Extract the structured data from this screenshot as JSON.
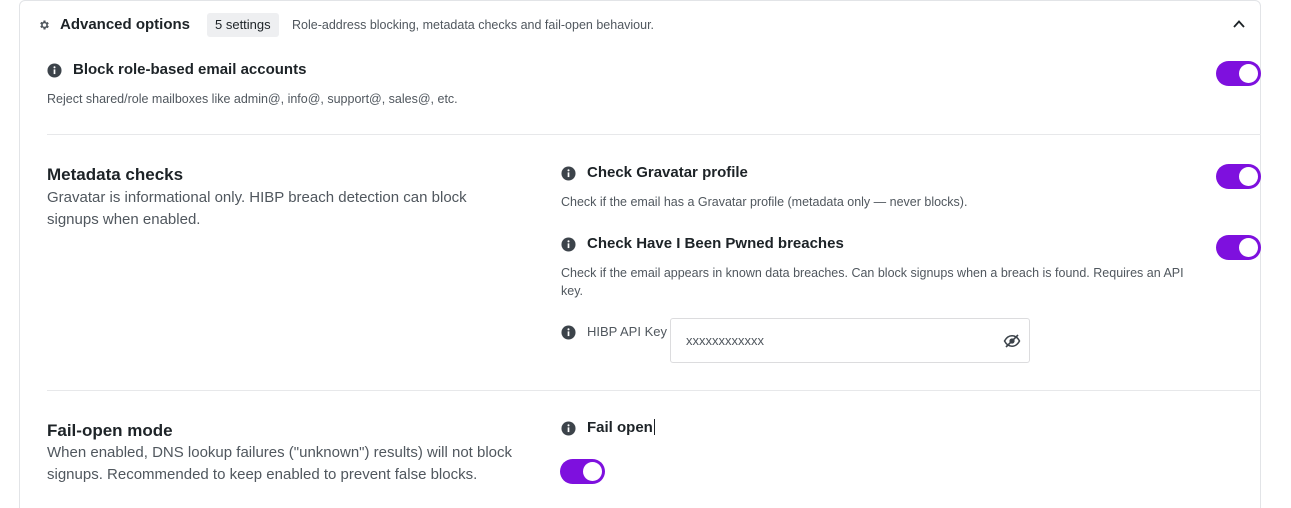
{
  "header": {
    "title": "Advanced options",
    "badge": "5 settings",
    "description": "Role-address blocking, metadata checks and fail-open behaviour."
  },
  "role_block": {
    "title": "Block role-based email accounts",
    "description": "Reject shared/role mailboxes like admin@, info@, support@, sales@, etc.",
    "enabled": true
  },
  "metadata": {
    "title": "Metadata checks",
    "description": "Gravatar is informational only. HIBP breach detection can block signups when enabled.",
    "gravatar": {
      "title": "Check Gravatar profile",
      "description": "Check if the email has a Gravatar profile (metadata only — never blocks).",
      "enabled": true
    },
    "hibp": {
      "title": "Check Have I Been Pwned breaches",
      "description": "Check if the email appears in known data breaches. Can block signups when a breach is found. Requires an API key.",
      "enabled": true
    },
    "api_key": {
      "label": "HIBP API Key",
      "value": "xxxxxxxxxxxx"
    }
  },
  "fail_open": {
    "title": "Fail-open mode",
    "description": "When enabled, DNS lookup failures (\"unknown\") results) will not block signups. Recommended to keep enabled to prevent false blocks.",
    "option_title": "Fail open",
    "enabled": true
  },
  "colors": {
    "accent": "#7e10de",
    "text": "#1d2327",
    "muted": "#50575e",
    "border": "#e2e4e7"
  },
  "icons": [
    "gear-icon",
    "chevron-up-icon",
    "info-icon",
    "eye-slash-icon"
  ]
}
